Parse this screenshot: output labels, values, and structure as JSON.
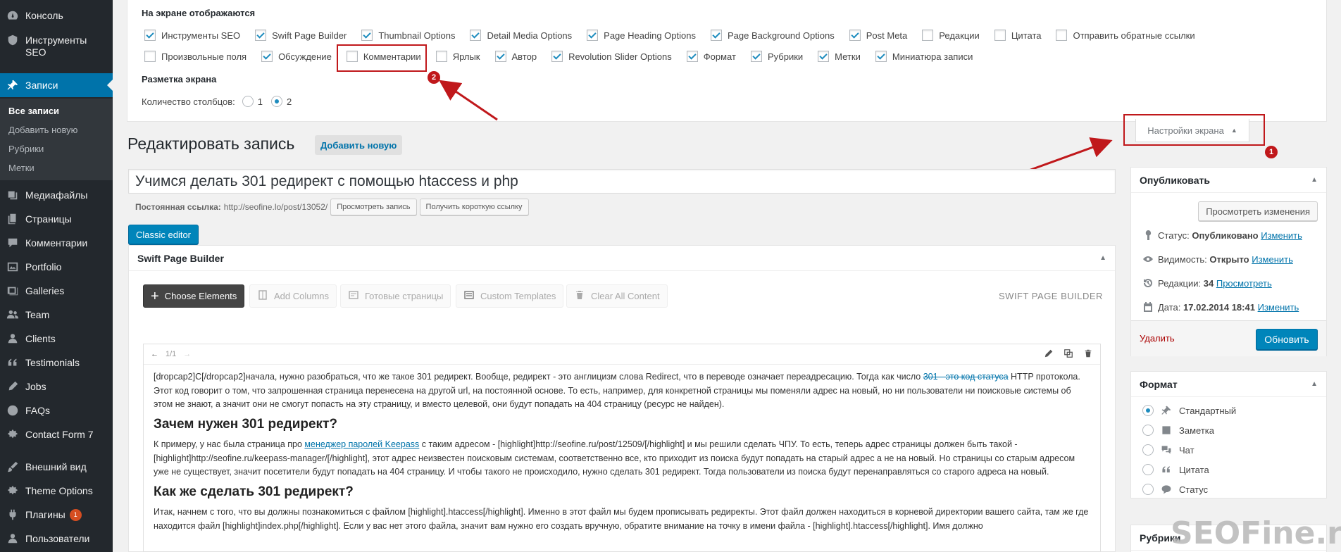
{
  "sidebar": {
    "items": [
      {
        "label": "Консоль",
        "icon": "dashboard-icon"
      },
      {
        "label": "Инструменты SEO",
        "icon": "shield-icon"
      },
      {
        "label": "Записи",
        "icon": "pin-icon"
      },
      {
        "label": "Медиафайлы",
        "icon": "media-icon"
      },
      {
        "label": "Страницы",
        "icon": "pages-icon"
      },
      {
        "label": "Комментарии",
        "icon": "comments-icon"
      },
      {
        "label": "Portfolio",
        "icon": "portfolio-icon"
      },
      {
        "label": "Galleries",
        "icon": "galleries-icon"
      },
      {
        "label": "Team",
        "icon": "team-icon"
      },
      {
        "label": "Clients",
        "icon": "clients-icon"
      },
      {
        "label": "Testimonials",
        "icon": "quote-icon"
      },
      {
        "label": "Jobs",
        "icon": "jobs-icon"
      },
      {
        "label": "FAQs",
        "icon": "faq-icon"
      },
      {
        "label": "Contact Form 7",
        "icon": "contact-form-icon"
      },
      {
        "label": "Внешний вид",
        "icon": "appearance-icon"
      },
      {
        "label": "Theme Options",
        "icon": "theme-options-icon"
      },
      {
        "label": "Плагины",
        "icon": "plugins-icon",
        "badge": "1"
      },
      {
        "label": "Пользователи",
        "icon": "users-icon"
      }
    ],
    "submenu": [
      "Все записи",
      "Добавить новую",
      "Рубрики",
      "Метки"
    ]
  },
  "screen_options": {
    "shown_title": "На экране отображаются",
    "row1": [
      {
        "label": "Инструменты SEO",
        "checked": true
      },
      {
        "label": "Swift Page Builder",
        "checked": true
      },
      {
        "label": "Thumbnail Options",
        "checked": true
      },
      {
        "label": "Detail Media Options",
        "checked": true
      },
      {
        "label": "Page Heading Options",
        "checked": true
      },
      {
        "label": "Page Background Options",
        "checked": true
      },
      {
        "label": "Post Meta",
        "checked": true
      },
      {
        "label": "Редакции",
        "checked": false
      },
      {
        "label": "Цитата",
        "checked": false
      },
      {
        "label": "Отправить обратные ссылки",
        "checked": false
      }
    ],
    "row2": [
      {
        "label": "Произвольные поля",
        "checked": false
      },
      {
        "label": "Обсуждение",
        "checked": true
      },
      {
        "label": "Комментарии",
        "checked": false
      },
      {
        "label": "Ярлык",
        "checked": false
      },
      {
        "label": "Автор",
        "checked": true
      },
      {
        "label": "Revolution Slider Options",
        "checked": true
      },
      {
        "label": "Формат",
        "checked": true
      },
      {
        "label": "Рубрики",
        "checked": true
      },
      {
        "label": "Метки",
        "checked": true
      },
      {
        "label": "Миниатюра записи",
        "checked": true
      }
    ],
    "layout_title": "Разметка экрана",
    "columns_label": "Количество столбцов:",
    "column_options": [
      "1",
      "2"
    ],
    "columns_selected": "2",
    "tab_label": "Настройки экрана"
  },
  "annotations": {
    "badge1": "1",
    "badge2": "2",
    "accent": "#c0181b"
  },
  "editor": {
    "page_title": "Редактировать запись",
    "add_new": "Добавить новую",
    "post_title": "Учимся делать 301 редирект с помощью htaccess и php",
    "permalink_label": "Постоянная ссылка:",
    "permalink_url": "http://seofine.lo/post/13052/",
    "view_post": "Просмотреть запись",
    "short_link": "Получить короткую ссылку",
    "classic_editor": "Classic editor"
  },
  "spb": {
    "title": "Swift Page Builder",
    "choose": "Choose Elements",
    "add_columns": "Add Columns",
    "ready_pages": "Готовые страницы",
    "custom_templates": "Custom Templates",
    "clear_all": "Clear All Content",
    "brand": "SWIFT PAGE BUILDER",
    "pager": "1/1"
  },
  "content": {
    "p1_a": "[dropcap2]С[/dropcap2]начала, нужно разобраться, что же такое 301 редирект. Вообще, редирект - это англицизм слова Redirect, что в переводе означает переадресацию. Тогда как число ",
    "p1_strike": "301 - это код статуса",
    "p1_b": " HTTP протокола. Этот код говорит о том, что запрошенная страница перенесена на другой url, на постоянной основе. То есть, например, для конкретной страницы мы поменяли адрес на новый, но ни пользователи ни поисковые системы об этом не знают, а значит они не смогут попасть на эту страницу, и вместо целевой, они будут попадать на 404 страницу (ресурс не найден).",
    "h1": "Зачем нужен 301 редирект?",
    "p2_a": "К примеру, у нас была страница про ",
    "p2_link": "менеджер паролей Keepass",
    "p2_b": " с таким адресом - [highlight]http://seofine.ru/post/12509/[/highlight] и мы решили сделать ЧПУ. То есть, теперь адрес страницы должен быть такой - [highlight]http://seofine.ru/keepass-manager/[/highlight], этот адрес неизвестен поисковым системам, соответственно все, кто приходит из поиска будут попадать на старый адрес а не на новый. Но страницы со старым адресом уже не существует, значит посетители будут попадать на 404 страницу. И чтобы такого не происходило, нужно сделать 301 редирект. Тогда пользователи из поиска будут перенаправляться со старого адреса на новый.",
    "h2": "Как же сделать 301 редирект?",
    "p3": "Итак, начнем с того, что вы должны познакомиться с файлом [highlight].htaccess[/highlight]. Именно в этот файл мы будем прописывать редиректы. Этот файл должен находиться в корневой директории вашего сайта, там же где находится файл [highlight]index.php[/highlight]. Если у вас нет этого файла, значит вам нужно его создать вручную, обратите внимание на точку в имени файла - [highlight].htaccess[/highlight]. Имя должно"
  },
  "publish": {
    "title": "Опубликовать",
    "preview": "Просмотреть изменения",
    "status_label": "Статус:",
    "status_value": "Опубликовано",
    "visibility_label": "Видимость:",
    "visibility_value": "Открыто",
    "revisions_label": "Редакции:",
    "revisions_value": "34",
    "date_label": "Дата:",
    "date_value": "17.02.2014 18:41",
    "edit": "Изменить",
    "view": "Просмотреть",
    "delete": "Удалить",
    "update": "Обновить"
  },
  "format": {
    "title": "Формат",
    "options": [
      {
        "label": "Стандартный",
        "icon": "pin-icon",
        "selected": true
      },
      {
        "label": "Заметка",
        "icon": "aside-icon",
        "selected": false
      },
      {
        "label": "Чат",
        "icon": "chat-icon",
        "selected": false
      },
      {
        "label": "Цитата",
        "icon": "quote-icon",
        "selected": false
      },
      {
        "label": "Статус",
        "icon": "status-icon",
        "selected": false
      }
    ]
  },
  "categories": {
    "title": "Рубрики"
  },
  "watermark": "SEOFine.ru"
}
